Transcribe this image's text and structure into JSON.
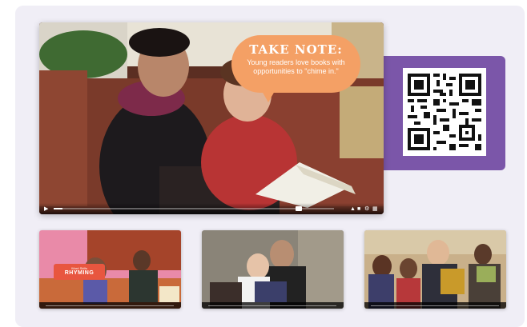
{
  "main_video": {
    "callout_title": "TAKE NOTE:",
    "callout_text": "Young readers love books with opportunities to \"chime in.\"",
    "progress": 0.03
  },
  "thumbnails": [
    {
      "name": "thumb-word-rhyming",
      "tag_small": "Word Skills",
      "tag_big": "RHYMING"
    },
    {
      "name": "thumb-mother-child-reading"
    },
    {
      "name": "thumb-group-reading"
    }
  ],
  "colors": {
    "panel_bg": "#f0eef6",
    "qr_card": "#7b56a9",
    "callout": "#f4a065",
    "word_tag": "#e8563f"
  },
  "icons": [
    "play-icon",
    "volume-icon",
    "captions-icon",
    "settings-icon",
    "fullscreen-icon",
    "qr-code-icon"
  ]
}
